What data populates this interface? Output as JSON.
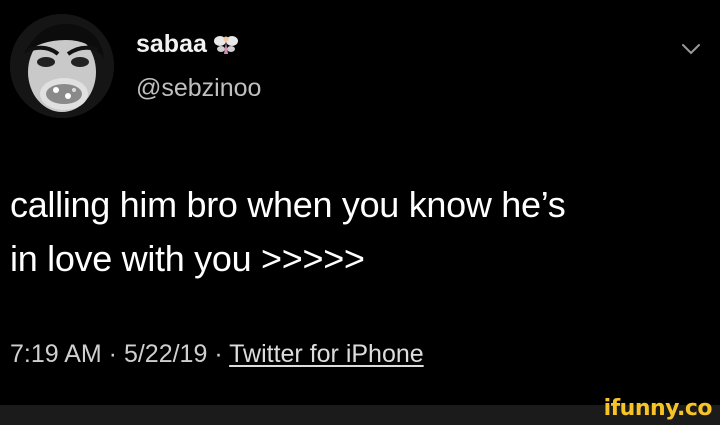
{
  "tweet": {
    "display_name": "sabaa",
    "handle": "@sebzinoo",
    "text_line1": "calling him bro when you know he’s",
    "text_line2": "in love with you >>>>>",
    "time": "7:19 AM",
    "date": "5/22/19",
    "source": "Twitter for iPhone",
    "separator": " · "
  },
  "icons": {
    "name_emoji": "fairy-icon",
    "menu": "chevron-down-icon"
  },
  "watermark": {
    "text": "ifunny.co",
    "color": "#f7c325"
  }
}
